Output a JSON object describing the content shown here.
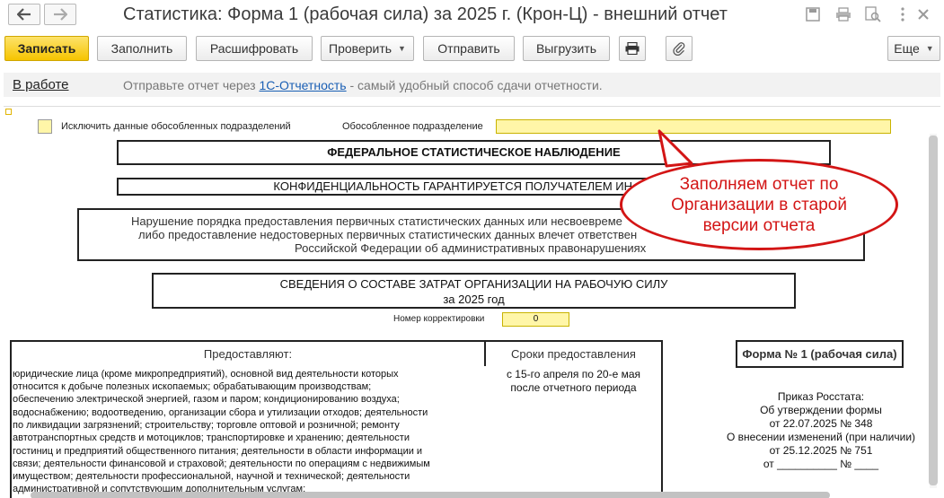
{
  "window": {
    "title": "Статистика: Форма 1 (рабочая сила) за 2025 г. (Крон-Ц) - внешний отчет",
    "back_icon": "arrow-left-icon",
    "forward_icon": "arrow-right-icon"
  },
  "toolbar": {
    "save_label": "Записать",
    "fill_label": "Заполнить",
    "decode_label": "Расшифровать",
    "check_label": "Проверить",
    "send_label": "Отправить",
    "export_label": "Выгрузить",
    "more_label": "Еще",
    "colors": {
      "primary": "#f6c400"
    }
  },
  "status": {
    "state_link": "В работе",
    "message_before": "Отправьте отчет через ",
    "message_link": "1С-Отчетность",
    "message_after": " - самый удобный способ сдачи отчетности."
  },
  "form": {
    "exclude_label": "Исключить данные обособленных подразделений",
    "subdivision_label": "Обособленное подразделение",
    "subdivision_value": "",
    "header_federal": "ФЕДЕРАЛЬНОЕ СТАТИСТИЧЕСКОЕ НАБЛЮДЕНИЕ",
    "header_confidential": "КОНФИДЕНЦИАЛЬНОСТЬ ГАРАНТИРУЕТСЯ ПОЛУЧАТЕЛЕМ ИН",
    "warning_lines": [
      "Нарушение порядка предоставления первичных статистических данных или несвоевреме",
      "либо предоставление недостоверных первичных статистических данных влечет ответствен",
      "Российской Федерации об административных правонарушениях"
    ],
    "report_title_line1": "СВЕДЕНИЯ О СОСТАВЕ ЗАТРАТ ОРГАНИЗАЦИИ НА РАБОЧУЮ СИЛУ",
    "report_title_line2": "за 2025 год",
    "correction_label": "Номер корректировки",
    "correction_value": "0",
    "col_provide": "Предоставляют:",
    "col_deadline": "Сроки предоставления",
    "form_number": "Форма № 1 (рабочая сила)",
    "provide_lines": [
      "юридические лица (кроме микропредприятий), основной вид деятельности которых",
      "относится к добыче полезных ископаемых; обрабатывающим производствам;",
      "обеспечению электрической энергией, газом и паром; кондиционированию воздуха;",
      "водоснабжению; водоотведению, организации сбора и утилизации отходов; деятельности",
      "по ликвидации загрязнений; строительству; торговле оптовой и розничной; ремонту",
      "автотранспортных средств и мотоциклов; транспортировке и хранению; деятельности",
      "гостиниц и предприятий общественного питания; деятельности в области информации и",
      "связи; деятельности финансовой и страховой; деятельности по операциям с недвижимым",
      "имуществом; деятельности профессиональной, научной и технической; деятельности",
      "административной и сопутствующим дополнительным услугам;"
    ],
    "deadline_lines": [
      "с 15-го апреля по 20-е мая",
      "после отчетного периода"
    ],
    "order_lines": [
      "Приказ Росстата:",
      "Об утверждении формы",
      "от 22.07.2025 № 348",
      "О внесении изменений (при наличии)",
      "от 25.12.2025 № 751",
      "от __________ № ____"
    ]
  },
  "callout": {
    "text_line1": "Заполняем отчет по",
    "text_line2": "Организации в старой",
    "text_line3": "версии отчета",
    "color": "#d31515"
  }
}
